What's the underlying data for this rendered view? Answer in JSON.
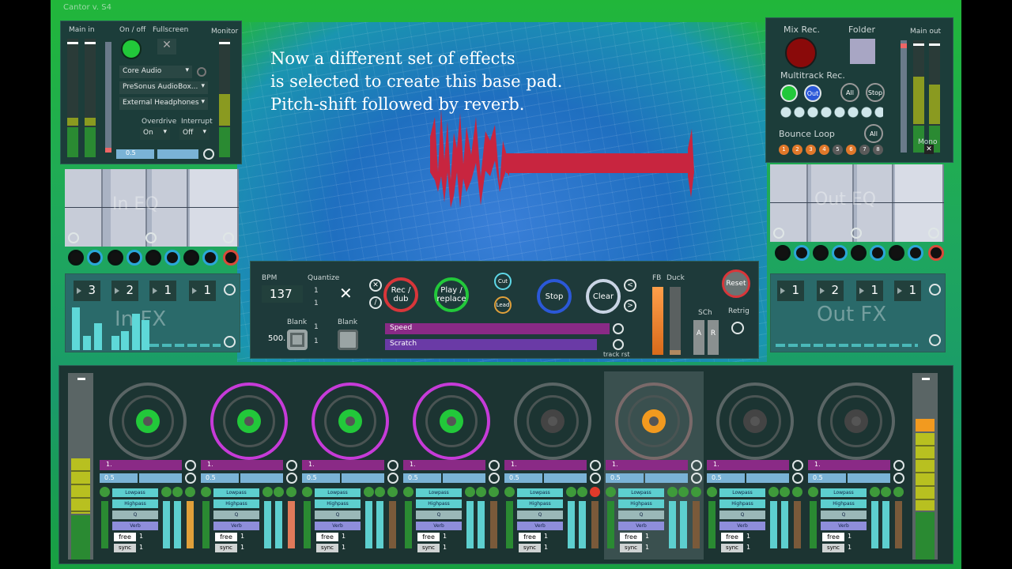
{
  "app": {
    "title": "Cantor v. S4"
  },
  "caption": {
    "line1": "Now a different set of effects",
    "line2": "is selected to create this base pad.",
    "line3": "Pitch-shift followed by reverb."
  },
  "input": {
    "main_in": "Main in",
    "on_off": "On / off",
    "fullscreen": "Fullscreen",
    "monitor": "Monitor",
    "driver": "Core Audio",
    "device": "PreSonus AudioBox...",
    "output": "External Headphones",
    "overdrive_label": "Overdrive",
    "overdrive_value": "On",
    "interrupt_label": "Interrupt",
    "interrupt_value": "Off",
    "gain": "0.5",
    "eq_label": "In EQ",
    "fx_label": "In FX",
    "fx_values": [
      "3",
      "2",
      "1",
      "1"
    ]
  },
  "output": {
    "mix_rec": "Mix Rec.",
    "folder": "Folder",
    "main_out": "Main out",
    "multitrack": "Multitrack Rec.",
    "out": "Out",
    "all": "All",
    "stop": "Stop",
    "bounce": "Bounce Loop",
    "mono": "Mono",
    "bounce_numbers": [
      "1",
      "2",
      "3",
      "4",
      "5",
      "6",
      "7",
      "8"
    ],
    "eq_label": "Out EQ",
    "fx_label": "Out FX",
    "fx_values": [
      "1",
      "2",
      "1",
      "1"
    ]
  },
  "transport": {
    "bpm_label": "BPM",
    "bpm": "137",
    "quantize": "Quantize",
    "q1": "1",
    "q2": "1",
    "blank1": "Blank",
    "blank2": "Blank",
    "ms": "500.",
    "b1": "1",
    "b2": "1",
    "recdub": "Rec / dub",
    "playreplace": "Play / replace",
    "cut": "Cut",
    "lead": "Lead",
    "stop": "Stop",
    "clear": "Clear",
    "fb": "FB",
    "duck": "Duck",
    "sch": "SCh",
    "a": "A",
    "r": "R",
    "reset": "Reset",
    "retrig": "Retrig",
    "speed": "Speed",
    "scratch": "Scratch",
    "trackrst": "track rst"
  },
  "tracks": [
    {
      "pitch": "1.",
      "vol": "0.5",
      "lowpass": "Lowpass",
      "highpass": "Highpass",
      "q": "Q",
      "verb": "Verb",
      "free": "free",
      "sync": "sync",
      "n1": "1",
      "n2": "1"
    },
    {
      "pitch": "1.",
      "vol": "0.5",
      "lowpass": "Lowpass",
      "highpass": "Highpass",
      "q": "Q",
      "verb": "Verb",
      "free": "free",
      "sync": "sync",
      "n1": "1",
      "n2": "1"
    },
    {
      "pitch": "1.",
      "vol": "0.5",
      "lowpass": "Lowpass",
      "highpass": "Highpass",
      "q": "Q",
      "verb": "Verb",
      "free": "free",
      "sync": "sync",
      "n1": "1",
      "n2": "1"
    },
    {
      "pitch": "1.",
      "vol": "0.5",
      "lowpass": "Lowpass",
      "highpass": "Highpass",
      "q": "Q",
      "verb": "Verb",
      "free": "free",
      "sync": "sync",
      "n1": "1",
      "n2": "1"
    },
    {
      "pitch": "1.",
      "vol": "0.5",
      "lowpass": "Lowpass",
      "highpass": "Highpass",
      "q": "Q",
      "verb": "Verb",
      "free": "free",
      "sync": "sync",
      "n1": "1",
      "n2": "1"
    },
    {
      "pitch": "1.",
      "vol": "0.5",
      "lowpass": "Lowpass",
      "highpass": "Highpass",
      "q": "Q",
      "verb": "Verb",
      "free": "free",
      "sync": "sync",
      "n1": "1",
      "n2": "1"
    },
    {
      "pitch": "1.",
      "vol": "0.5",
      "lowpass": "Lowpass",
      "highpass": "Highpass",
      "q": "Q",
      "verb": "Verb",
      "free": "free",
      "sync": "sync",
      "n1": "1",
      "n2": "1"
    },
    {
      "pitch": "1.",
      "vol": "0.5",
      "lowpass": "Lowpass",
      "highpass": "Highpass",
      "q": "Q",
      "verb": "Verb",
      "free": "free",
      "sync": "sync",
      "n1": "1",
      "n2": "1"
    }
  ],
  "colors": {
    "accent_green": "#22c83a",
    "magenta": "#c63bd8",
    "orange": "#f29a1f",
    "waveform": "#c8253f"
  }
}
